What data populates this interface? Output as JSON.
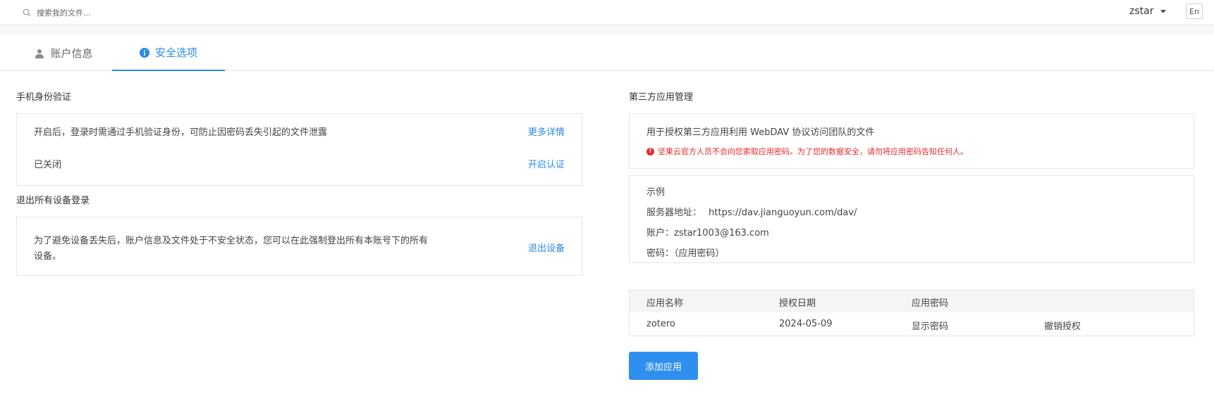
{
  "search": {
    "placeholder": "搜索我的文件..."
  },
  "header": {
    "username": "zstar",
    "language_button": "En"
  },
  "tabs": [
    {
      "label": "账户信息",
      "icon": "user-icon"
    },
    {
      "label": "安全选项",
      "icon": "info-icon"
    }
  ],
  "phone_auth": {
    "title": "手机身份验证",
    "description": "开启后，登录时需通过手机验证身份，可防止因密码丢失引起的文件泄露",
    "more_link": "更多详情",
    "status": "已关闭",
    "enable_link": "开启认证"
  },
  "logout_devices": {
    "title": "退出所有设备登录",
    "description_line1": "为了避免设备丢失后，账户信息及文件处于不安全状态，您可以在此强制登出所有本账号下的所有",
    "description_line2": "设备。",
    "logout_link": "退出设备"
  },
  "third_party": {
    "title": "第三方应用管理",
    "description": "用于授权第三方应用利用 WebDAV 协议访问团队的文件",
    "warning": "坚果云官方人员不会向您索取应用密码。为了您的数据安全，请勿将应用密码告知任何人。",
    "example_title": "示例",
    "server_label": "服务器地址：",
    "server_value": "https://dav.jianguoyun.com/dav/",
    "account_label": "账户：",
    "account_value": "zstar1003@163.com",
    "password_label": "密码：",
    "password_value": "（应用密码）",
    "table": {
      "headers": [
        "应用名称",
        "授权日期",
        "应用密码"
      ],
      "rows": [
        {
          "name": "zotero",
          "date": "2024-05-09",
          "show_password": "显示密码",
          "revoke": "撤销授权"
        }
      ]
    },
    "add_button": "添加应用"
  },
  "colors": {
    "accent": "#2b8ae6",
    "warning": "#e8282b",
    "button": "#2e8fef"
  }
}
